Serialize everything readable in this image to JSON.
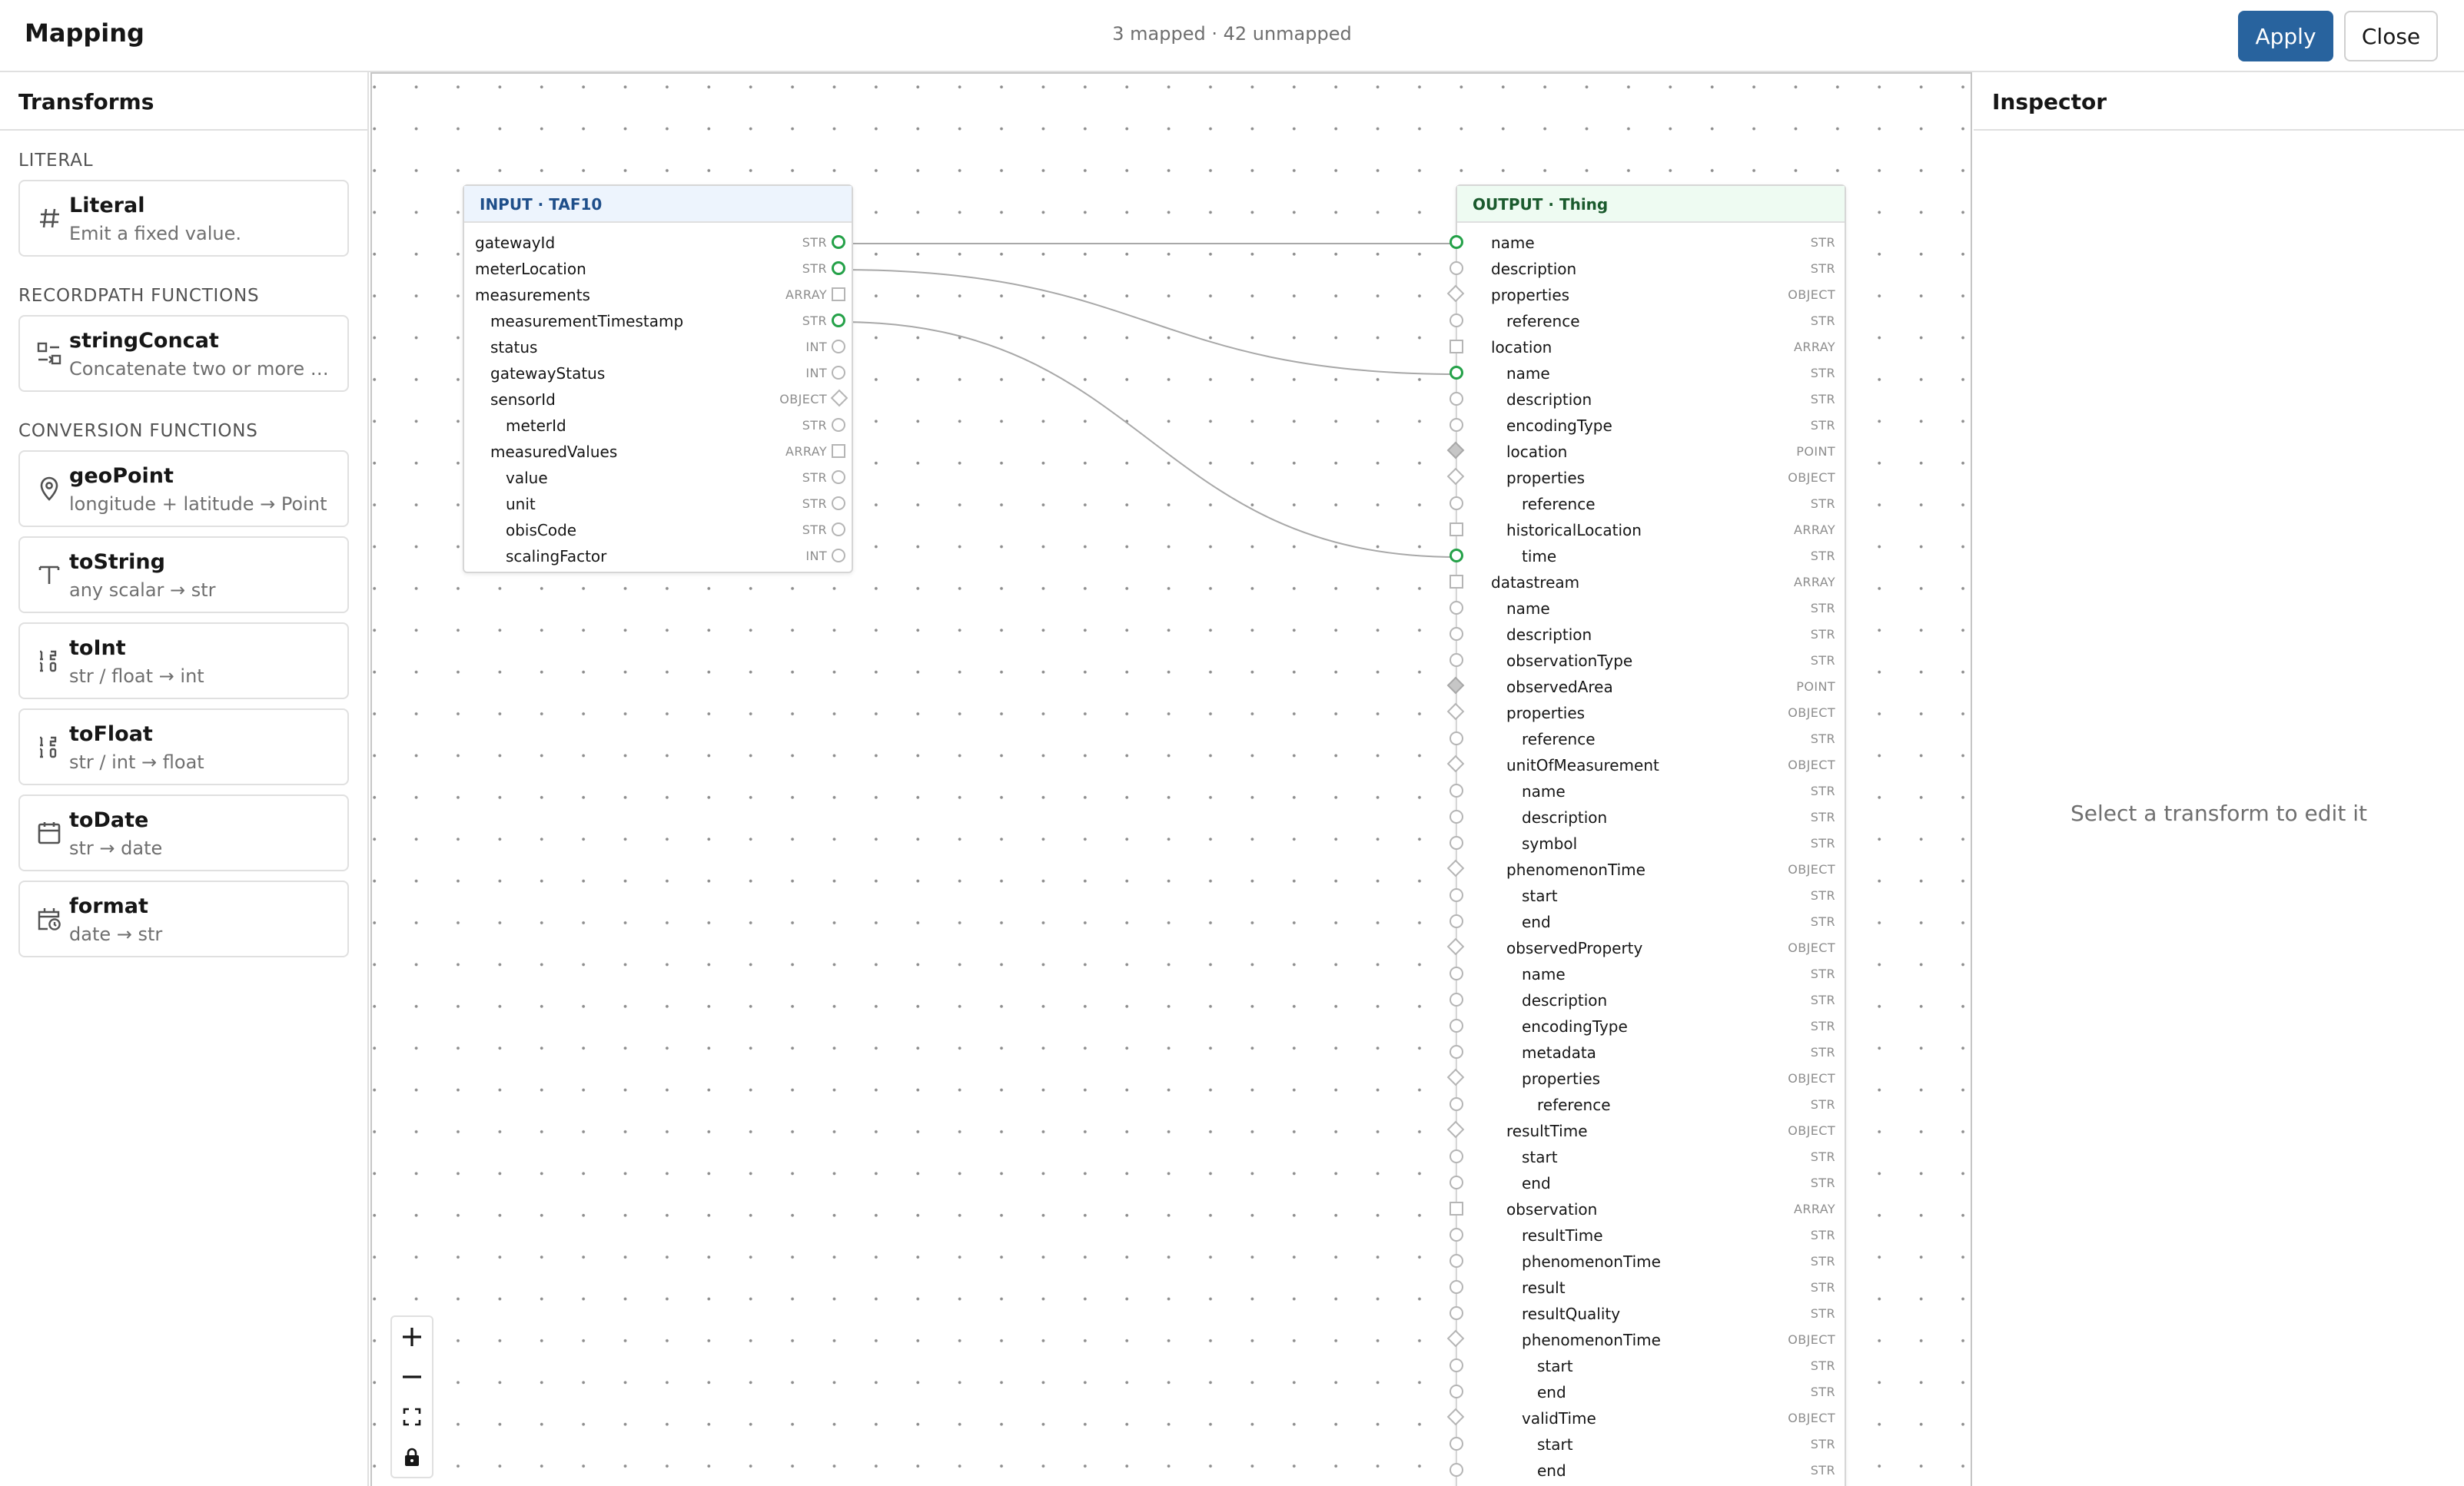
{
  "header": {
    "title": "Mapping",
    "status": "3 mapped · 42 unmapped",
    "apply_label": "Apply",
    "close_label": "Close"
  },
  "transforms": {
    "title": "Transforms",
    "sections": [
      {
        "label": "LITERAL",
        "items": [
          {
            "name": "Literal",
            "desc": "Emit a fixed value.",
            "icon": "hash-icon"
          }
        ]
      },
      {
        "label": "RECORDPATH FUNCTIONS",
        "items": [
          {
            "name": "stringConcat",
            "desc": "Concatenate two or more valu...",
            "icon": "concat-icon"
          }
        ]
      },
      {
        "label": "CONVERSION FUNCTIONS",
        "items": [
          {
            "name": "geoPoint",
            "desc": "longitude + latitude → Point",
            "icon": "map-pin-icon"
          },
          {
            "name": "toString",
            "desc": "any scalar → str",
            "icon": "text-icon"
          },
          {
            "name": "toInt",
            "desc": "str / float → int",
            "icon": "number-icon"
          },
          {
            "name": "toFloat",
            "desc": "str / int → float",
            "icon": "number-icon"
          },
          {
            "name": "toDate",
            "desc": "str → date",
            "icon": "calendar-icon"
          },
          {
            "name": "format",
            "desc": "date → str",
            "icon": "calendar-clock-icon"
          }
        ]
      }
    ]
  },
  "canvas": {
    "input_node": {
      "title": "INPUT · TAF10",
      "fields": [
        {
          "name": "gatewayId",
          "type": "STR",
          "port": "circle",
          "mapped": true,
          "depth": 0
        },
        {
          "name": "meterLocation",
          "type": "STR",
          "port": "circle",
          "mapped": true,
          "depth": 0
        },
        {
          "name": "measurements",
          "type": "ARRAY",
          "port": "square",
          "mapped": false,
          "depth": 0
        },
        {
          "name": "measurementTimestamp",
          "type": "STR",
          "port": "circle",
          "mapped": true,
          "depth": 1
        },
        {
          "name": "status",
          "type": "INT",
          "port": "circle",
          "mapped": false,
          "depth": 1
        },
        {
          "name": "gatewayStatus",
          "type": "INT",
          "port": "circle",
          "mapped": false,
          "depth": 1
        },
        {
          "name": "sensorId",
          "type": "OBJECT",
          "port": "diamond",
          "mapped": false,
          "depth": 1
        },
        {
          "name": "meterId",
          "type": "STR",
          "port": "circle",
          "mapped": false,
          "depth": 2
        },
        {
          "name": "measuredValues",
          "type": "ARRAY",
          "port": "square",
          "mapped": false,
          "depth": 1
        },
        {
          "name": "value",
          "type": "STR",
          "port": "circle",
          "mapped": false,
          "depth": 2
        },
        {
          "name": "unit",
          "type": "STR",
          "port": "circle",
          "mapped": false,
          "depth": 2
        },
        {
          "name": "obisCode",
          "type": "STR",
          "port": "circle",
          "mapped": false,
          "depth": 2
        },
        {
          "name": "scalingFactor",
          "type": "INT",
          "port": "circle",
          "mapped": false,
          "depth": 2
        }
      ]
    },
    "output_node": {
      "title": "OUTPUT · Thing",
      "fields": [
        {
          "name": "name",
          "type": "STR",
          "port": "circle",
          "mapped": true,
          "depth": 0
        },
        {
          "name": "description",
          "type": "STR",
          "port": "circle",
          "mapped": false,
          "depth": 0
        },
        {
          "name": "properties",
          "type": "OBJECT",
          "port": "diamond",
          "mapped": false,
          "depth": 0
        },
        {
          "name": "reference",
          "type": "STR",
          "port": "circle",
          "mapped": false,
          "depth": 1
        },
        {
          "name": "location",
          "type": "ARRAY",
          "port": "square",
          "mapped": false,
          "depth": 0
        },
        {
          "name": "name",
          "type": "STR",
          "port": "circle",
          "mapped": true,
          "depth": 1
        },
        {
          "name": "description",
          "type": "STR",
          "port": "circle",
          "mapped": false,
          "depth": 1
        },
        {
          "name": "encodingType",
          "type": "STR",
          "port": "circle",
          "mapped": false,
          "depth": 1
        },
        {
          "name": "location",
          "type": "POINT",
          "port": "diamond-filled",
          "mapped": false,
          "depth": 1
        },
        {
          "name": "properties",
          "type": "OBJECT",
          "port": "diamond",
          "mapped": false,
          "depth": 1
        },
        {
          "name": "reference",
          "type": "STR",
          "port": "circle",
          "mapped": false,
          "depth": 2
        },
        {
          "name": "historicalLocation",
          "type": "ARRAY",
          "port": "square",
          "mapped": false,
          "depth": 1
        },
        {
          "name": "time",
          "type": "STR",
          "port": "circle",
          "mapped": true,
          "depth": 2
        },
        {
          "name": "datastream",
          "type": "ARRAY",
          "port": "square",
          "mapped": false,
          "depth": 0
        },
        {
          "name": "name",
          "type": "STR",
          "port": "circle",
          "mapped": false,
          "depth": 1
        },
        {
          "name": "description",
          "type": "STR",
          "port": "circle",
          "mapped": false,
          "depth": 1
        },
        {
          "name": "observationType",
          "type": "STR",
          "port": "circle",
          "mapped": false,
          "depth": 1
        },
        {
          "name": "observedArea",
          "type": "POINT",
          "port": "diamond-filled",
          "mapped": false,
          "depth": 1
        },
        {
          "name": "properties",
          "type": "OBJECT",
          "port": "diamond",
          "mapped": false,
          "depth": 1
        },
        {
          "name": "reference",
          "type": "STR",
          "port": "circle",
          "mapped": false,
          "depth": 2
        },
        {
          "name": "unitOfMeasurement",
          "type": "OBJECT",
          "port": "diamond",
          "mapped": false,
          "depth": 1
        },
        {
          "name": "name",
          "type": "STR",
          "port": "circle",
          "mapped": false,
          "depth": 2
        },
        {
          "name": "description",
          "type": "STR",
          "port": "circle",
          "mapped": false,
          "depth": 2
        },
        {
          "name": "symbol",
          "type": "STR",
          "port": "circle",
          "mapped": false,
          "depth": 2
        },
        {
          "name": "phenomenonTime",
          "type": "OBJECT",
          "port": "diamond",
          "mapped": false,
          "depth": 1
        },
        {
          "name": "start",
          "type": "STR",
          "port": "circle",
          "mapped": false,
          "depth": 2
        },
        {
          "name": "end",
          "type": "STR",
          "port": "circle",
          "mapped": false,
          "depth": 2
        },
        {
          "name": "observedProperty",
          "type": "OBJECT",
          "port": "diamond",
          "mapped": false,
          "depth": 1
        },
        {
          "name": "name",
          "type": "STR",
          "port": "circle",
          "mapped": false,
          "depth": 2
        },
        {
          "name": "description",
          "type": "STR",
          "port": "circle",
          "mapped": false,
          "depth": 2
        },
        {
          "name": "encodingType",
          "type": "STR",
          "port": "circle",
          "mapped": false,
          "depth": 2
        },
        {
          "name": "metadata",
          "type": "STR",
          "port": "circle",
          "mapped": false,
          "depth": 2
        },
        {
          "name": "properties",
          "type": "OBJECT",
          "port": "diamond",
          "mapped": false,
          "depth": 2
        },
        {
          "name": "reference",
          "type": "STR",
          "port": "circle",
          "mapped": false,
          "depth": 3
        },
        {
          "name": "resultTime",
          "type": "OBJECT",
          "port": "diamond",
          "mapped": false,
          "depth": 1
        },
        {
          "name": "start",
          "type": "STR",
          "port": "circle",
          "mapped": false,
          "depth": 2
        },
        {
          "name": "end",
          "type": "STR",
          "port": "circle",
          "mapped": false,
          "depth": 2
        },
        {
          "name": "observation",
          "type": "ARRAY",
          "port": "square",
          "mapped": false,
          "depth": 1
        },
        {
          "name": "resultTime",
          "type": "STR",
          "port": "circle",
          "mapped": false,
          "depth": 2
        },
        {
          "name": "phenomenonTime",
          "type": "STR",
          "port": "circle",
          "mapped": false,
          "depth": 2
        },
        {
          "name": "result",
          "type": "STR",
          "port": "circle",
          "mapped": false,
          "depth": 2
        },
        {
          "name": "resultQuality",
          "type": "STR",
          "port": "circle",
          "mapped": false,
          "depth": 2
        },
        {
          "name": "phenomenonTime",
          "type": "OBJECT",
          "port": "diamond",
          "mapped": false,
          "depth": 2
        },
        {
          "name": "start",
          "type": "STR",
          "port": "circle",
          "mapped": false,
          "depth": 3
        },
        {
          "name": "end",
          "type": "STR",
          "port": "circle",
          "mapped": false,
          "depth": 3
        },
        {
          "name": "validTime",
          "type": "OBJECT",
          "port": "diamond",
          "mapped": false,
          "depth": 2
        },
        {
          "name": "start",
          "type": "STR",
          "port": "circle",
          "mapped": false,
          "depth": 3
        },
        {
          "name": "end",
          "type": "STR",
          "port": "circle",
          "mapped": false,
          "depth": 3
        }
      ]
    },
    "connections": [
      {
        "from": "gatewayId",
        "to": "name"
      },
      {
        "from": "meterLocation",
        "to": "location.name"
      },
      {
        "from": "measurementTimestamp",
        "to": "historicalLocation.time"
      }
    ],
    "zoom_controls": [
      "zoom-in-icon",
      "zoom-out-icon",
      "fit-view-icon",
      "lock-icon"
    ]
  },
  "inspector": {
    "title": "Inspector",
    "empty_text": "Select a transform to edit it"
  },
  "colors": {
    "accent": "#28639e",
    "mapped_port": "#24a148",
    "input_header": "#edf4fd",
    "output_header": "#eefbf2"
  }
}
